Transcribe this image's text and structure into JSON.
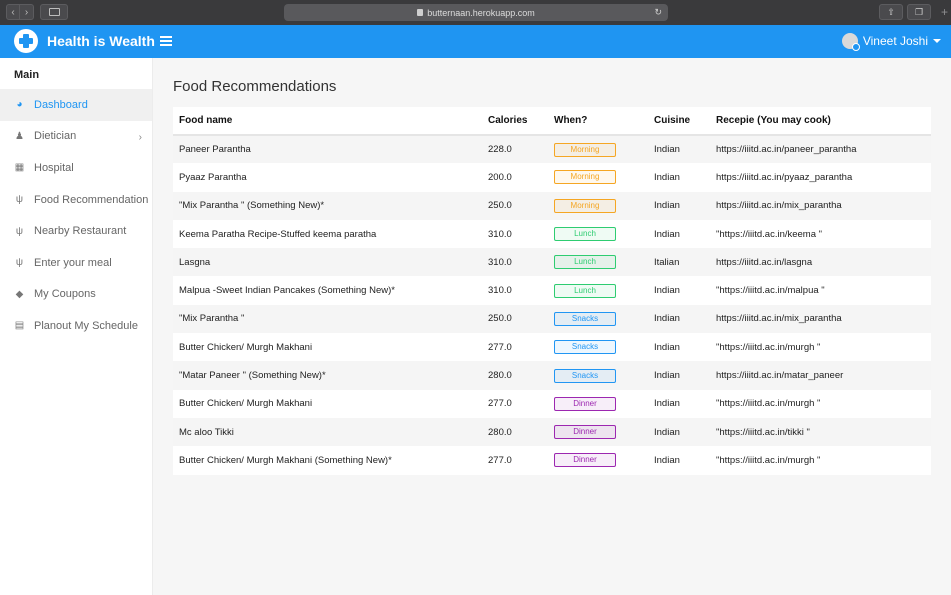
{
  "browser": {
    "url": "butternaan.herokuapp.com"
  },
  "app": {
    "title": "Health is Wealth",
    "user": "Vineet Joshi"
  },
  "sidebar": {
    "heading": "Main",
    "items": [
      {
        "label": "Dashboard",
        "icon": "dashboard-icon"
      },
      {
        "label": "Dietician",
        "icon": "user-icon",
        "chevron": true
      },
      {
        "label": "Hospital",
        "icon": "hospital-icon"
      },
      {
        "label": "Food Recommendation",
        "icon": "cutlery-icon"
      },
      {
        "label": "Nearby Restaurant",
        "icon": "cutlery-icon"
      },
      {
        "label": "Enter your meal",
        "icon": "cutlery-icon"
      },
      {
        "label": "My Coupons",
        "icon": "tag-icon"
      },
      {
        "label": "Planout My Schedule",
        "icon": "calendar-icon"
      }
    ],
    "active_index": 0
  },
  "main": {
    "title": "Food Recommendations",
    "columns": [
      "Food name",
      "Calories",
      "When?",
      "Cuisine",
      "Recepie (You may cook)"
    ],
    "rows": [
      {
        "name": "Paneer Parantha",
        "calories": "228.0",
        "when": "Morning",
        "cuisine": "Indian",
        "recipe": "https://iiitd.ac.in/paneer_parantha"
      },
      {
        "name": "Pyaaz Parantha",
        "calories": "200.0",
        "when": "Morning",
        "cuisine": "Indian",
        "recipe": "https://iiitd.ac.in/pyaaz_parantha"
      },
      {
        "name": "\"Mix Parantha \" (Something New)*",
        "calories": "250.0",
        "when": "Morning",
        "cuisine": "Indian",
        "recipe": "https://iiitd.ac.in/mix_parantha"
      },
      {
        "name": "Keema Paratha Recipe-Stuffed keema paratha",
        "calories": "310.0",
        "when": "Lunch",
        "cuisine": "Indian",
        "recipe": "\"https://iiitd.ac.in/keema \""
      },
      {
        "name": "Lasgna",
        "calories": "310.0",
        "when": "Lunch",
        "cuisine": "Italian",
        "recipe": "https://iiitd.ac.in/lasgna"
      },
      {
        "name": "Malpua -Sweet Indian Pancakes (Something New)*",
        "calories": "310.0",
        "when": "Lunch",
        "cuisine": "Indian",
        "recipe": "\"https://iiitd.ac.in/malpua \""
      },
      {
        "name": "\"Mix Parantha \"",
        "calories": "250.0",
        "when": "Snacks",
        "cuisine": "Indian",
        "recipe": "https://iiitd.ac.in/mix_parantha"
      },
      {
        "name": "Butter Chicken/ Murgh Makhani",
        "calories": "277.0",
        "when": "Snacks",
        "cuisine": "Indian",
        "recipe": "\"https://iiitd.ac.in/murgh \""
      },
      {
        "name": "\"Matar Paneer \" (Something New)*",
        "calories": "280.0",
        "when": "Snacks",
        "cuisine": "Indian",
        "recipe": "https://iiitd.ac.in/matar_paneer"
      },
      {
        "name": "Butter Chicken/ Murgh Makhani",
        "calories": "277.0",
        "when": "Dinner",
        "cuisine": "Indian",
        "recipe": "\"https://iiitd.ac.in/murgh \""
      },
      {
        "name": "Mc aloo Tikki",
        "calories": "280.0",
        "when": "Dinner",
        "cuisine": "Indian",
        "recipe": "\"https://iiitd.ac.in/tikki \""
      },
      {
        "name": "Butter Chicken/ Murgh Makhani (Something New)*",
        "calories": "277.0",
        "when": "Dinner",
        "cuisine": "Indian",
        "recipe": "\"https://iiitd.ac.in/murgh \""
      }
    ]
  },
  "colors": {
    "primary": "#1f95f2",
    "Morning": "#f5a623",
    "Lunch": "#2ecc71",
    "Snacks": "#2196f3",
    "Dinner": "#9c27b0"
  }
}
